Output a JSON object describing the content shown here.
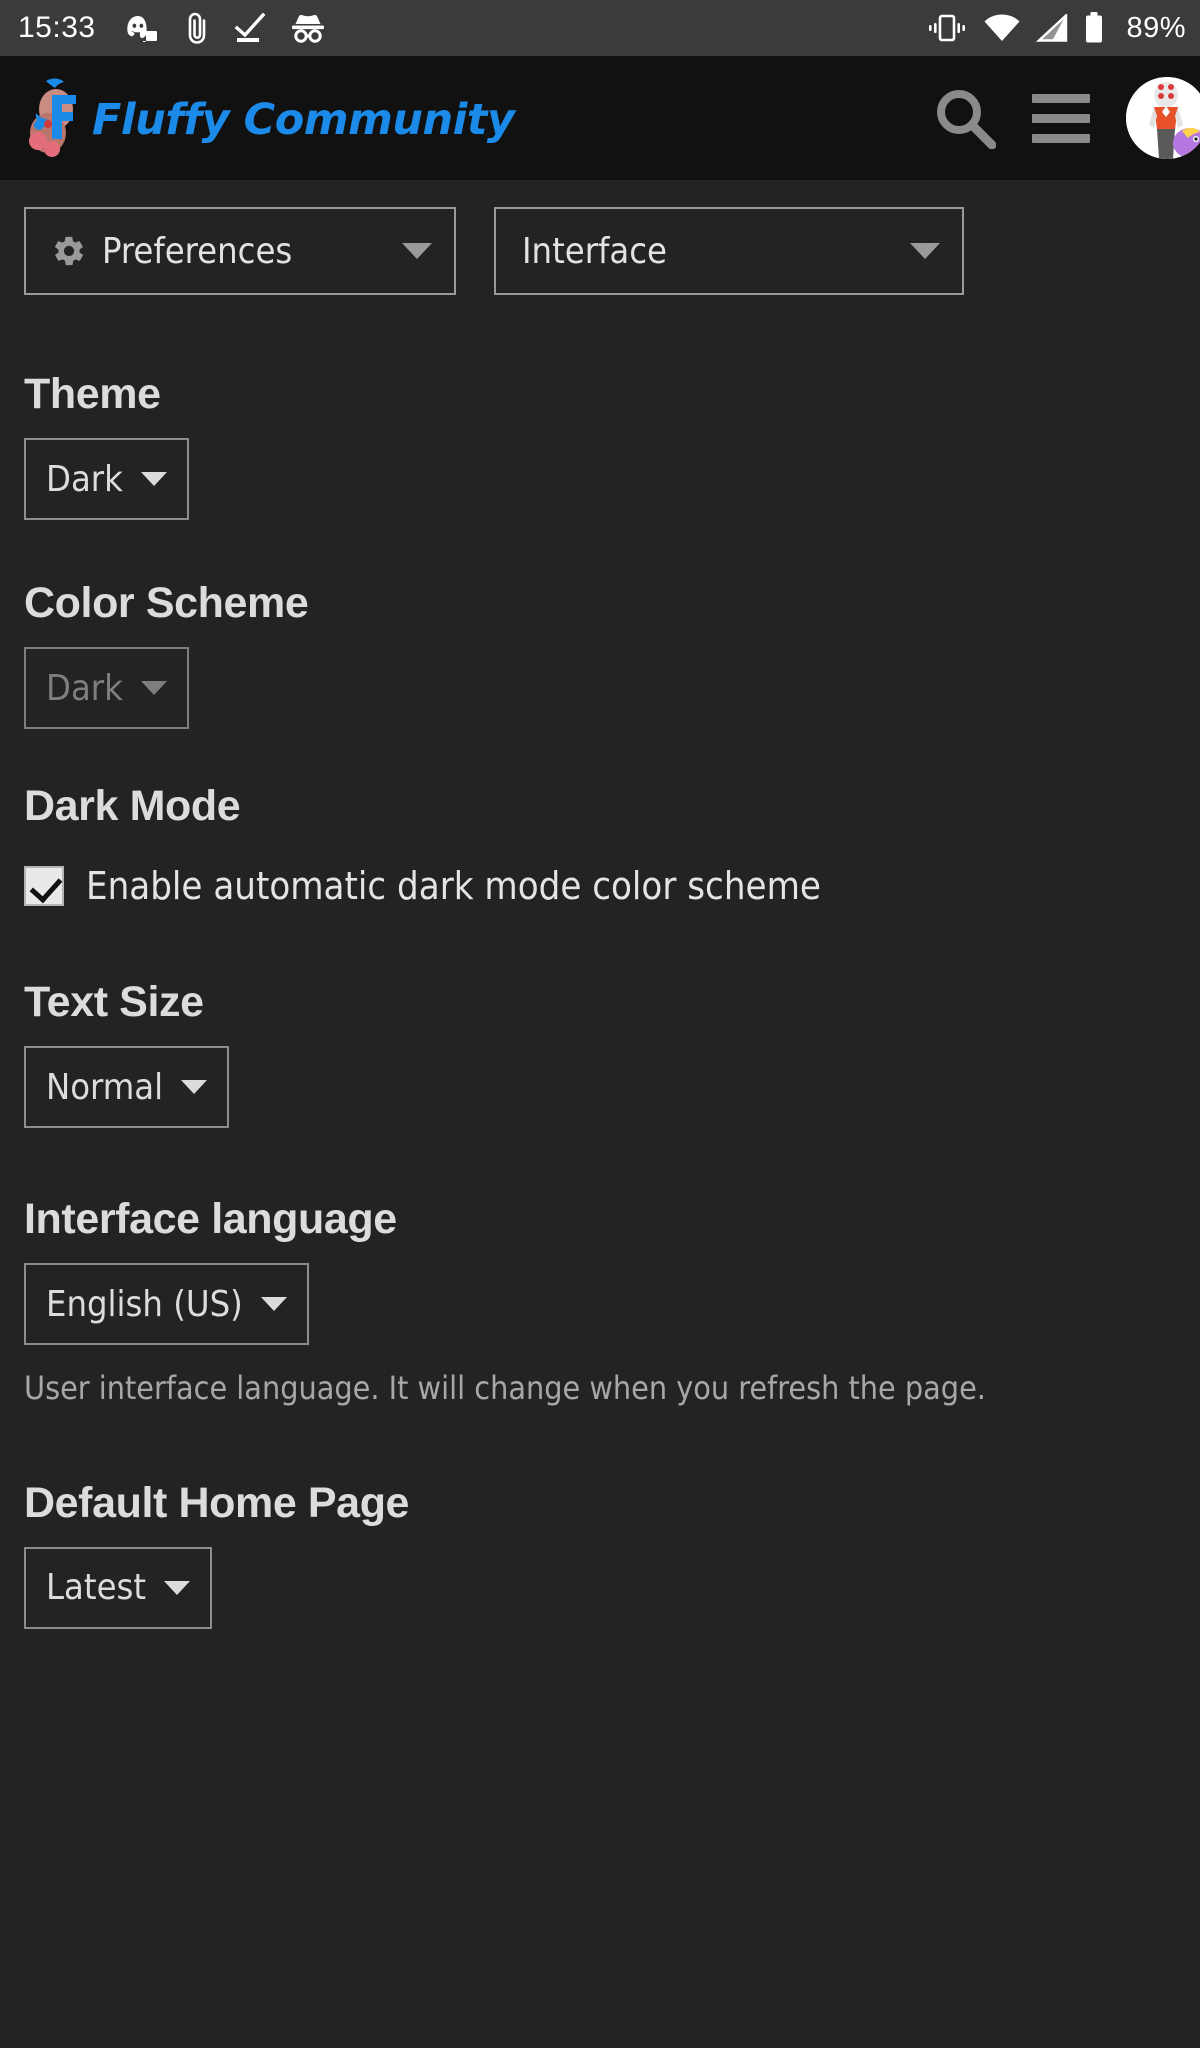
{
  "statusbar": {
    "time": "15:33",
    "battery_percent": "89%",
    "left_icons": [
      "discord-icon",
      "attachment-icon",
      "download-complete-icon",
      "incognito-icon"
    ],
    "right_icons": [
      "vibrate-icon",
      "wifi-icon",
      "cell-signal-icon",
      "battery-icon"
    ]
  },
  "header": {
    "logo_text": "Fluffy Community",
    "logo_color": "#1b8ae8",
    "search_label": "search-icon",
    "menu_label": "hamburger-menu-icon",
    "avatar_label": "user-avatar"
  },
  "nav": {
    "primary": {
      "label": "Preferences",
      "icon": "gear-icon"
    },
    "secondary": {
      "label": "Interface"
    }
  },
  "sections": {
    "theme": {
      "heading": "Theme",
      "value": "Dark"
    },
    "color_scheme": {
      "heading": "Color Scheme",
      "value": "Dark",
      "disabled": true
    },
    "dark_mode": {
      "heading": "Dark Mode",
      "checkbox_label": "Enable automatic dark mode color scheme",
      "checked": true
    },
    "text_size": {
      "heading": "Text Size",
      "value": "Normal"
    },
    "interface_language": {
      "heading": "Interface language",
      "value": "English (US)",
      "help": "User interface language. It will change when you refresh the page."
    },
    "default_home_page": {
      "heading": "Default Home Page",
      "value": "Latest"
    }
  },
  "colors": {
    "page_bg": "#232323",
    "header_bg": "#111111",
    "statusbar_bg": "#3a3b3d",
    "border": "#8d8d8d",
    "text": "#dcdcdc",
    "muted_text": "#a7a7a7"
  }
}
